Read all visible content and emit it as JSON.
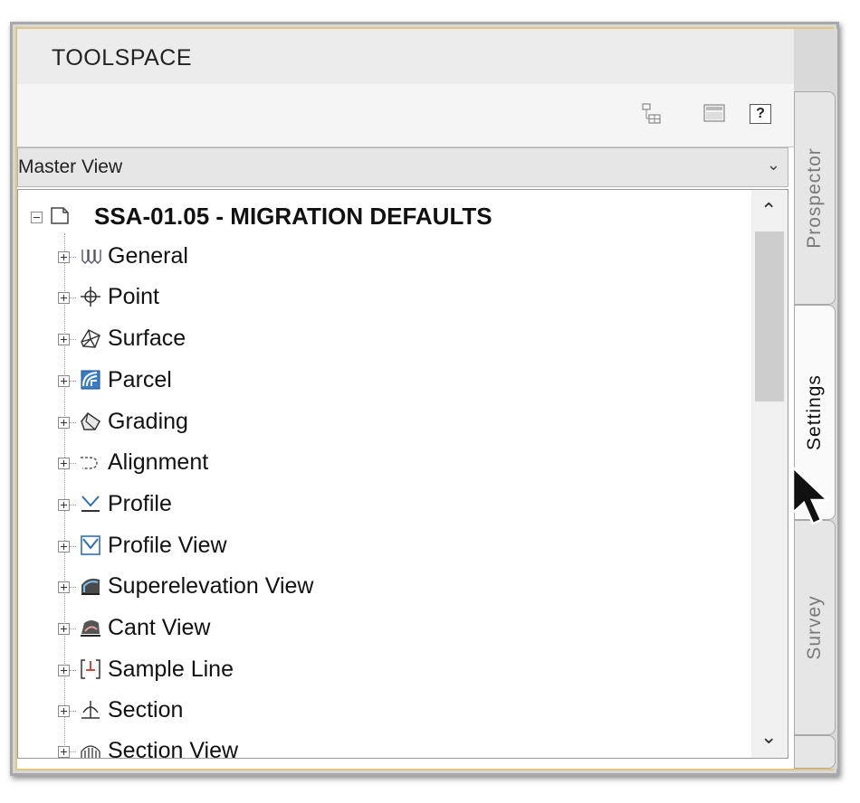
{
  "palette": {
    "title_bg": "#ececec",
    "frame_accent": "#e2c47a",
    "scroll_thumb": "#cdcdcd"
  },
  "window": {
    "title": "TOOLSPACE"
  },
  "toolbar": {
    "buttons": [
      {
        "icon": "copy-tree-icon"
      },
      {
        "icon": "panel-icon"
      },
      {
        "icon": "help-icon",
        "label": "?"
      }
    ]
  },
  "view_select": {
    "value": "Master View"
  },
  "tree": {
    "root": {
      "label": "SSA-01.05 - MIGRATION DEFAULTS",
      "icon": "drawing-file-icon"
    },
    "items": [
      {
        "label": "General",
        "icon": "general-icon"
      },
      {
        "label": "Point",
        "icon": "point-icon"
      },
      {
        "label": "Surface",
        "icon": "surface-icon"
      },
      {
        "label": "Parcel",
        "icon": "parcel-icon"
      },
      {
        "label": "Grading",
        "icon": "grading-icon"
      },
      {
        "label": "Alignment",
        "icon": "alignment-icon"
      },
      {
        "label": "Profile",
        "icon": "profile-icon"
      },
      {
        "label": "Profile View",
        "icon": "profile-view-icon"
      },
      {
        "label": "Superelevation View",
        "icon": "superelevation-view-icon"
      },
      {
        "label": "Cant View",
        "icon": "cant-view-icon"
      },
      {
        "label": "Sample Line",
        "icon": "sample-line-icon"
      },
      {
        "label": "Section",
        "icon": "section-icon"
      },
      {
        "label": "Section View",
        "icon": "section-view-icon"
      }
    ]
  },
  "tabs": [
    {
      "label": "Prospector",
      "active": false
    },
    {
      "label": "Settings",
      "active": true
    },
    {
      "label": "Survey",
      "active": false
    }
  ]
}
